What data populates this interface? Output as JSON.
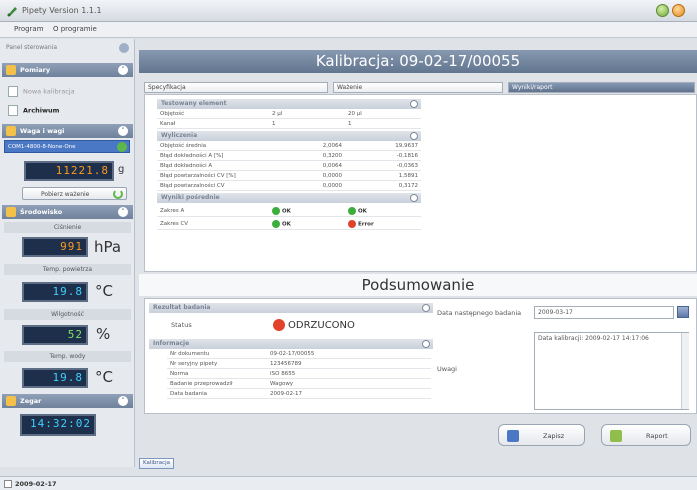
{
  "window": {
    "title": "Pipety Version 1.1.1"
  },
  "menu": {
    "items": [
      "Program",
      "O programie"
    ]
  },
  "sidebar": {
    "top_label": "Panel sterowania",
    "sections": {
      "pomiary": "Pomiary",
      "waga": "Waga i wagi",
      "srodowisko": "Środowisko",
      "zegar": "Zegar"
    },
    "links": {
      "new_calibration": "Nowa kalibracja",
      "archive": "Archiwum"
    },
    "port": "COM1-4800-8-None-One",
    "scale": {
      "value": "11221.8",
      "unit": "g",
      "button": "Pobierz ważenie"
    },
    "pressure": {
      "label": "Ciśnienie",
      "value": "991",
      "unit": "hPa"
    },
    "air_temp": {
      "label": "Temp. powietrza",
      "value": "19.8",
      "unit": "°C"
    },
    "humidity": {
      "label": "Wilgotność",
      "value": "52",
      "unit": "%"
    },
    "water_temp": {
      "label": "Temp. wody",
      "value": "19.8",
      "unit": "°C"
    },
    "clock": "14:32:02"
  },
  "main": {
    "title": "Kalibracja: 09-02-17/00055",
    "tabs": [
      "Specyfikacja",
      "Ważenie",
      "Wyniki/raport"
    ],
    "tested": {
      "header": "Testowany element",
      "rows": [
        {
          "label": "Objętość",
          "a": "2 µl",
          "b": "20 µl"
        },
        {
          "label": "Kanał",
          "a": "1",
          "b": "1"
        }
      ]
    },
    "calc": {
      "header": "Wyliczenia",
      "rows": [
        {
          "label": "Objętość średnia",
          "a": "2,0064",
          "b": "19,9637"
        },
        {
          "label": "Błąd dokładności A [%]",
          "a": "0,3200",
          "b": "-0,1816"
        },
        {
          "label": "Błąd dokładności A",
          "a": "0,0064",
          "b": "-0,0363"
        },
        {
          "label": "Błąd powtarzalności CV [%]",
          "a": "0,0000",
          "b": "1,5891"
        },
        {
          "label": "Błąd powtarzalności CV",
          "a": "0,0000",
          "b": "0,3172"
        }
      ]
    },
    "partial": {
      "header": "Wyniki pośrednie",
      "rows": [
        {
          "label": "Zakres A",
          "a": "OK",
          "b": "OK"
        },
        {
          "label": "Zakres CV",
          "a": "OK",
          "b": "Error"
        }
      ]
    },
    "summary_title": "Podsumowanie",
    "result": {
      "header": "Rezultat badania",
      "label": "Status",
      "value": "ODRZUCONO"
    },
    "info": {
      "header": "Informacje",
      "rows": [
        {
          "label": "Nr dokumentu",
          "value": "09-02-17/00055"
        },
        {
          "label": "Nr seryjny pipety",
          "value": "123456789"
        },
        {
          "label": "Norma",
          "value": "ISO 8655"
        },
        {
          "label": "Badanie przeprowadził",
          "value": "Wagowy"
        },
        {
          "label": "Data badania",
          "value": "2009-02-17"
        }
      ]
    },
    "next_test": {
      "label": "Data następnego badania",
      "value": "2009-03-17"
    },
    "notes": {
      "label": "Uwagi",
      "value": "Data kalibracji: 2009-02-17 14:17:06"
    },
    "buttons": {
      "save": "Zapisz",
      "report": "Raport"
    },
    "bottom_tab": "Kalibracja"
  },
  "statusbar": {
    "date": "2009-02-17"
  }
}
